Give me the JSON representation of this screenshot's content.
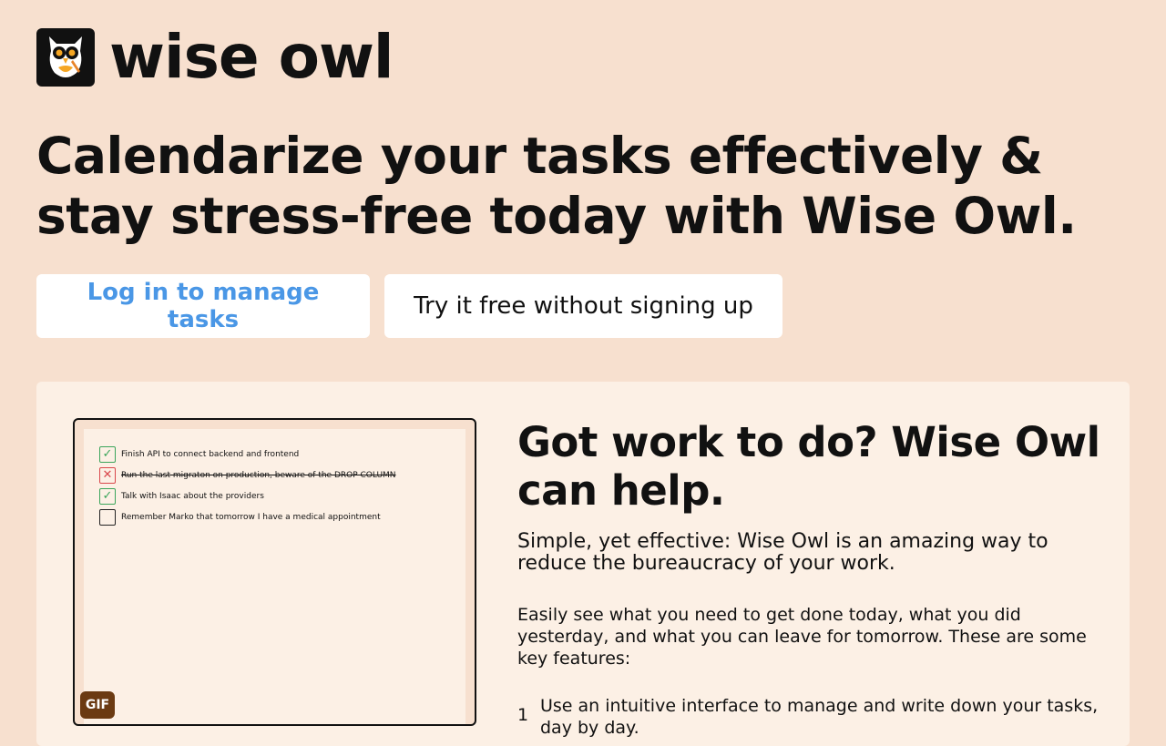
{
  "brand": {
    "name": "wise owl",
    "logo_icon": "owl-icon"
  },
  "hero": {
    "title": "Calendarize your tasks effectively & stay stress-free today with Wise Owl."
  },
  "cta": {
    "login_label": "Log in to manage tasks",
    "try_label": "Try it free without signing up"
  },
  "colors": {
    "background": "#f7e0cf",
    "panel": "#fcf0e5",
    "accent": "#4a97e6",
    "gif_badge": "#6b3a12"
  },
  "demo": {
    "gif_label": "GIF",
    "tasks": [
      {
        "text": "Finish API to connect backend and frontend",
        "status": "done"
      },
      {
        "text": "Run the last migraton on production, beware of the DROP COLUMN",
        "status": "failed"
      },
      {
        "text": "Talk with Isaac about the providers",
        "status": "done"
      },
      {
        "text": "Remember Marko that tomorrow I have a medical appointment",
        "status": "open"
      }
    ]
  },
  "info": {
    "heading": "Got work to do? Wise Owl can help.",
    "subheading": "Simple, yet effective: Wise Owl is an amazing way to reduce the bureaucracy of your work.",
    "description": "Easily see what you need to get done today, what you did yesterday, and what you can leave for tomorrow. These are some key features:",
    "features": [
      {
        "number": "1",
        "text": "Use an intuitive interface to manage and write down your tasks, day by day."
      }
    ]
  }
}
